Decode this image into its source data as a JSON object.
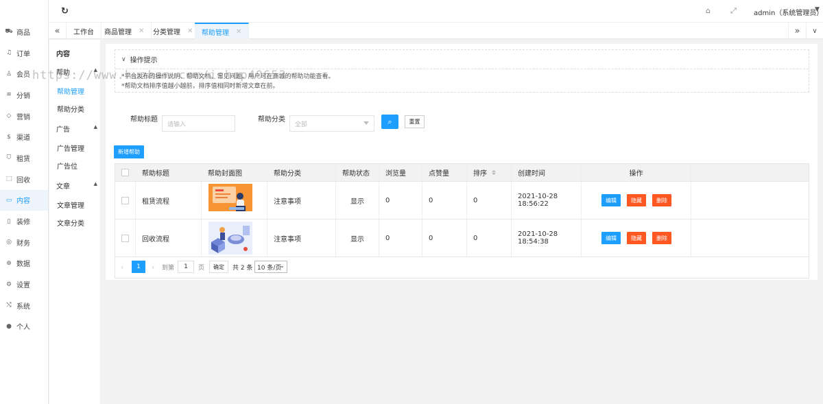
{
  "sidebar": {
    "items": [
      {
        "label": "商品",
        "icon": "cart-icon"
      },
      {
        "label": "订单",
        "icon": "bell-icon"
      },
      {
        "label": "会员",
        "icon": "user-icon"
      },
      {
        "label": "分销",
        "icon": "layers-icon"
      },
      {
        "label": "营销",
        "icon": "diamond-icon"
      },
      {
        "label": "渠道",
        "icon": "dollar-icon"
      },
      {
        "label": "租赁",
        "icon": "shield-icon"
      },
      {
        "label": "回收",
        "icon": "recycle-icon"
      },
      {
        "label": "内容",
        "icon": "book-icon",
        "active": true
      },
      {
        "label": "装修",
        "icon": "phone-icon"
      },
      {
        "label": "财务",
        "icon": "finance-icon"
      },
      {
        "label": "数据",
        "icon": "globe-icon"
      },
      {
        "label": "设置",
        "icon": "gear-icon"
      },
      {
        "label": "系统",
        "icon": "shuffle-icon"
      },
      {
        "label": "个人",
        "icon": "person-icon"
      }
    ]
  },
  "header": {
    "user": "admin（系统管理员）",
    "refresh_glyph": "↻",
    "tag_glyph": "⌂",
    "fullscreen_glyph": "⤢"
  },
  "tabs": [
    {
      "label": "工作台",
      "closable": false
    },
    {
      "label": "商品管理",
      "closable": true
    },
    {
      "label": "分类管理",
      "closable": true
    },
    {
      "label": "帮助管理",
      "closable": true,
      "active": true
    }
  ],
  "submenu": {
    "title": "内容",
    "groups": [
      {
        "label": "帮助",
        "items": [
          "帮助管理",
          "帮助分类"
        ]
      },
      {
        "label": "广告",
        "items": [
          "广告管理",
          "广告位"
        ]
      },
      {
        "label": "文章",
        "items": [
          "文章管理",
          "文章分类"
        ]
      }
    ],
    "active_item": "帮助管理"
  },
  "tips": {
    "title": "操作提示",
    "lines": [
      "*平台发布的操作说明、帮助文档、常见问题。用户可在商城的帮助功能查看。",
      "*帮助文档排序值越小越前，排序值相同时新增文章在前。"
    ]
  },
  "filters": {
    "title_label": "帮助标题",
    "title_placeholder": "请输入",
    "category_label": "帮助分类",
    "category_value": "全部",
    "search_glyph": "⌕",
    "reset_label": "重置"
  },
  "add_button": "新增帮助",
  "table": {
    "headers": [
      "帮助标题",
      "帮助封面图",
      "帮助分类",
      "帮助状态",
      "浏览量",
      "点赞量",
      "排序",
      "创建时间",
      "操作"
    ],
    "rows": [
      {
        "title": "租赁流程",
        "category": "注意事项",
        "status": "显示",
        "views": "0",
        "likes": "0",
        "sort": "0",
        "created": "2021-10-28 18:56:22"
      },
      {
        "title": "回收流程",
        "category": "注意事项",
        "status": "显示",
        "views": "0",
        "likes": "0",
        "sort": "0",
        "created": "2021-10-28 18:54:38"
      }
    ],
    "actions": {
      "edit": "编辑",
      "hide": "隐藏",
      "delete": "删除"
    }
  },
  "pager": {
    "current": "1",
    "goto_label": "到第",
    "goto_value": "1",
    "page_unit": "页",
    "confirm": "确定",
    "total": "共 2 条",
    "page_size": "10 条/页"
  },
  "watermark": "https://www.huzhan.com/ishop40653",
  "colors": {
    "accent": "#1e9fff",
    "danger": "#ff5722"
  }
}
